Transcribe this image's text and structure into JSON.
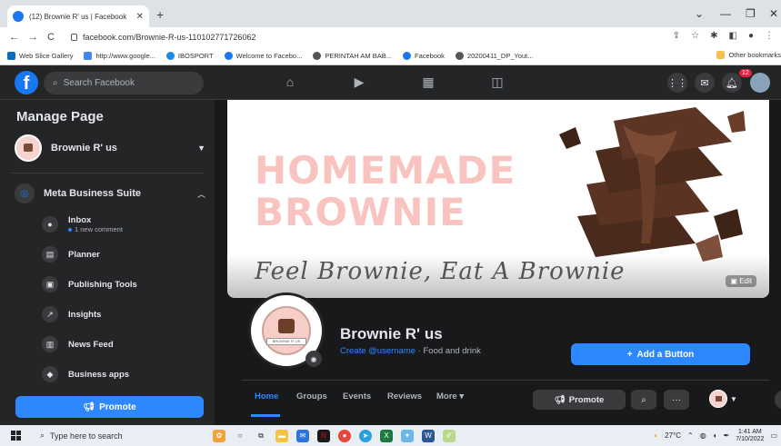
{
  "browser": {
    "tab_title": "(12) Brownie R' us | Facebook",
    "tab_close": "✕",
    "new_tab": "+",
    "url": "facebook.com/Brownie-R-us-110102771726062",
    "bookmarks": [
      {
        "label": "Web Slice Gallery",
        "color": "#0a6ebd"
      },
      {
        "label": "http://www.google...",
        "color": "#4285f4"
      },
      {
        "label": "IBOSPORT",
        "color": "#1e88e5"
      },
      {
        "label": "Welcome to Facebo...",
        "color": "#1877f2"
      },
      {
        "label": "PERINTAH AM BAB...",
        "color": "#555555"
      },
      {
        "label": "Facebook",
        "color": "#1877f2"
      },
      {
        "label": "20200411_DP_Yout...",
        "color": "#555555"
      }
    ],
    "other_bookmarks": "Other bookmarks"
  },
  "fb": {
    "search_placeholder": "Search Facebook",
    "notification_count": "12"
  },
  "sidebar": {
    "title": "Manage Page",
    "page_name": "Brownie R' us",
    "business_suite": "Meta Business Suite",
    "items": [
      {
        "label": "Inbox",
        "sub": "1 new comment"
      },
      {
        "label": "Planner"
      },
      {
        "label": "Publishing Tools"
      },
      {
        "label": "Insights"
      },
      {
        "label": "News Feed"
      },
      {
        "label": "Business apps"
      }
    ],
    "promote": "Promote"
  },
  "cover": {
    "line1": "HOMEMADE",
    "line2": "BROWNIE",
    "tagline": "Feel Brownie, Eat A Brownie",
    "edit": "Edit"
  },
  "profile": {
    "name": "Brownie R' us",
    "username_link": "Create @username",
    "category": " · Food and drink",
    "logo_text": "BROWNIE R' US",
    "add_button": "Add a Button"
  },
  "page_tabs": {
    "items": [
      "Home",
      "Groups",
      "Events",
      "Reviews",
      "More ▾"
    ],
    "promote": "Promote",
    "more": "···"
  },
  "taskbar": {
    "search_placeholder": "Type here to search",
    "temperature": "27°C",
    "time": "1:41 AM",
    "date": "7/10/2022"
  }
}
